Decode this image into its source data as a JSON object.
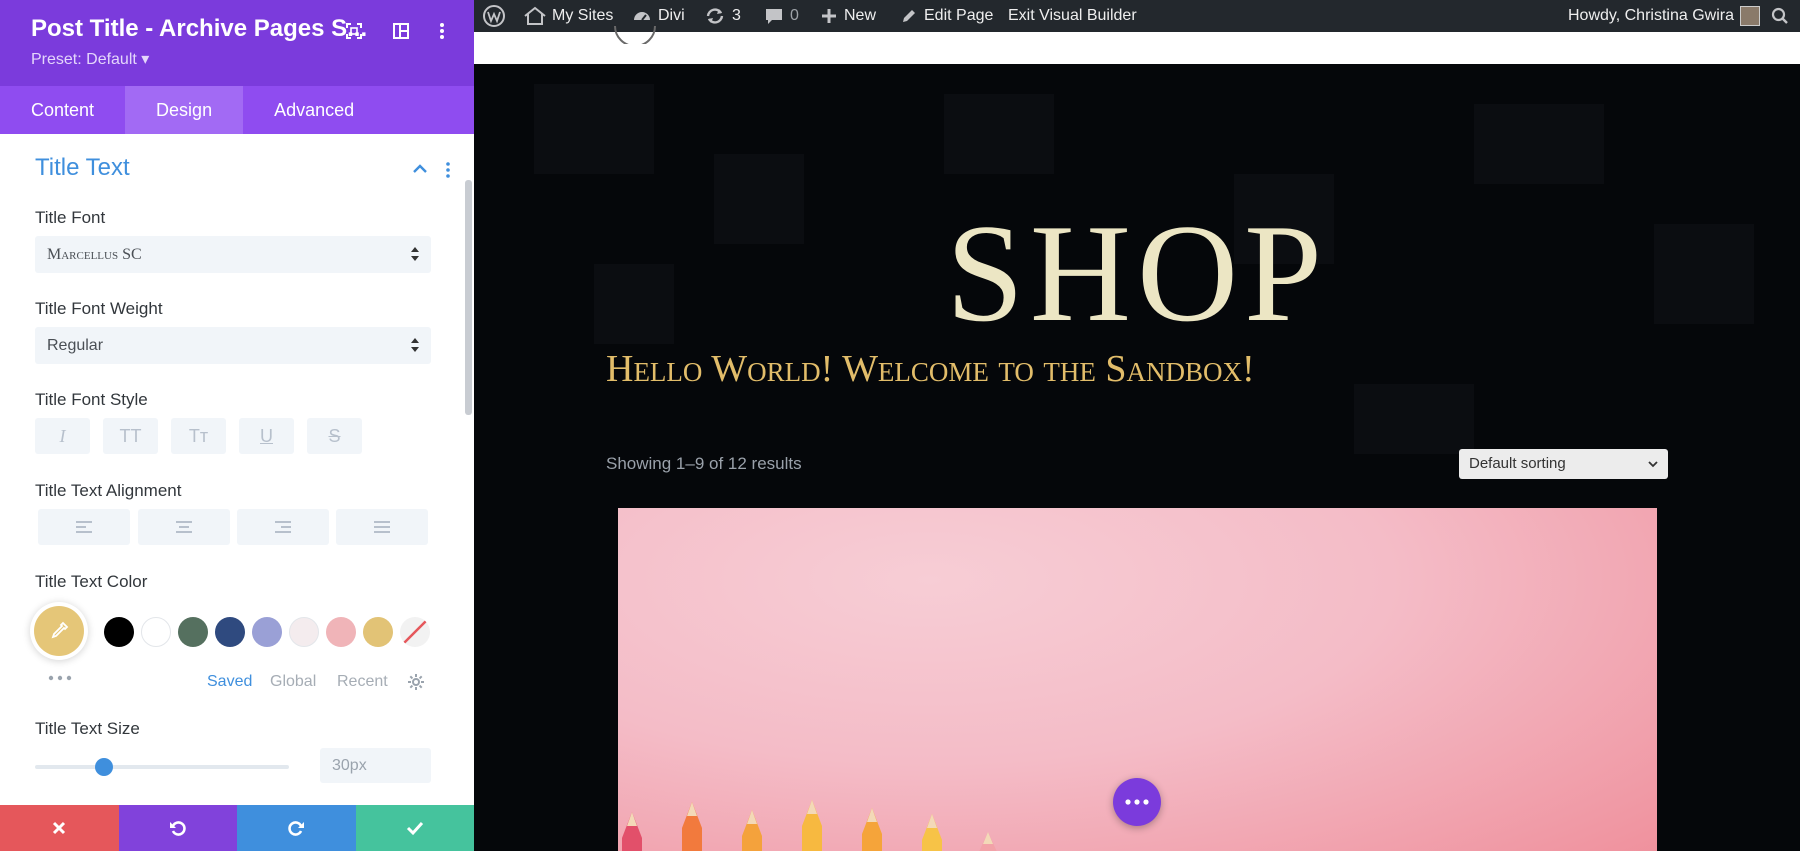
{
  "panel": {
    "title": "Post Title - Archive Pages S...",
    "preset": "Preset: Default ▾",
    "tabs": [
      {
        "label": "Content"
      },
      {
        "label": "Design"
      },
      {
        "label": "Advanced"
      }
    ],
    "active_tab": "Design",
    "section": {
      "title": "Title Text",
      "font_label": "Title Font",
      "font_value": "Marcellus SC",
      "weight_label": "Title Font Weight",
      "weight_value": "Regular",
      "style_label": "Title Font Style",
      "style_buttons": [
        "I",
        "TT",
        "Tт",
        "U",
        "S"
      ],
      "alignment_label": "Title Text Alignment",
      "color_label": "Title Text Color",
      "selected_color": "#e5c678",
      "swatches": [
        "#000000",
        "#ffffff",
        "#55705f",
        "#2f4a7f",
        "#9aa0d6",
        "#f4ecee",
        "#f0b4b8",
        "#e2c376",
        "none"
      ],
      "palette_tabs": [
        "Saved",
        "Global",
        "Recent"
      ],
      "size_label": "Title Text Size",
      "size_value": "30px",
      "size_slider_fraction": 0.27
    },
    "footer_colors": {
      "cancel": "#e5575b",
      "undo": "#8142db",
      "redo": "#3f8fdd",
      "save": "#45c39d"
    }
  },
  "adminbar": {
    "my_sites": "My Sites",
    "divi": "Divi",
    "updates_count": "3",
    "comments_count": "0",
    "new": "New",
    "edit_page": "Edit Page",
    "exit_builder": "Exit Visual Builder",
    "howdy": "Howdy, Christina Gwira"
  },
  "page": {
    "shop_title": "SHOP",
    "post_title": "Hello World! Welcome to the Sandbox!",
    "result_count": "Showing 1–9 of 12 results",
    "sorting": "Default sorting"
  }
}
